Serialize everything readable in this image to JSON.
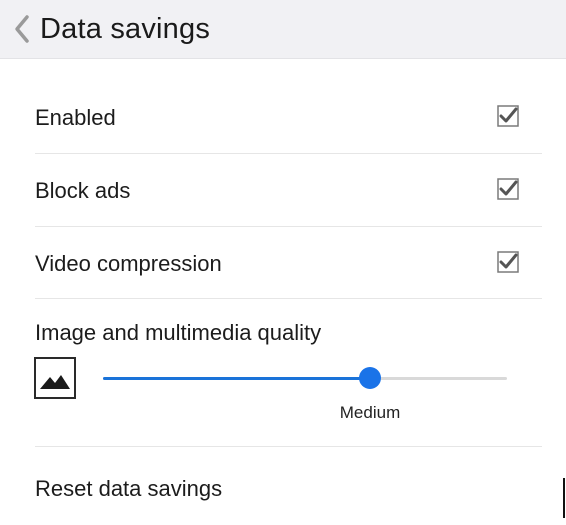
{
  "header": {
    "title": "Data savings",
    "back_icon": "chevron-left-icon"
  },
  "settings": [
    {
      "label": "Enabled",
      "checked": true
    },
    {
      "label": "Block ads",
      "checked": true
    },
    {
      "label": "Video compression",
      "checked": true
    }
  ],
  "quality": {
    "label": "Image and multimedia quality",
    "icon": "image-icon",
    "value_label": "Medium",
    "level": 0.66
  },
  "reset": {
    "label": "Reset data savings"
  },
  "colors": {
    "accent": "#1a73e8",
    "header_bg": "#f1f1f4",
    "checkmark": "#555555"
  }
}
